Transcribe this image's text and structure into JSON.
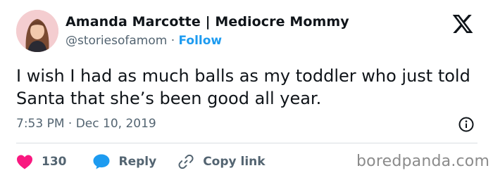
{
  "author": {
    "display_name": "Amanda Marcotte | Mediocre Mommy",
    "handle": "@storiesofamom",
    "separator": "·",
    "follow_label": "Follow"
  },
  "tweet": {
    "text": "I wish I had as much balls as my toddler who just told Santa that she’s been good all year.",
    "time": "7:53 PM",
    "date_separator": "·",
    "date": "Dec 10, 2019"
  },
  "actions": {
    "like_count": "130",
    "reply_label": "Reply",
    "copy_link_label": "Copy link"
  },
  "watermark": "boredpanda.com",
  "icons": {
    "brand": "x-logo-icon",
    "info": "info-icon",
    "like": "heart-icon",
    "reply": "chat-bubble-icon",
    "copy": "link-icon"
  },
  "colors": {
    "like_heart": "#f91880",
    "reply_bubble": "#1d9bf0",
    "follow_link": "#1d9bf0",
    "secondary_text": "#536471",
    "primary_text": "#0f1419"
  }
}
